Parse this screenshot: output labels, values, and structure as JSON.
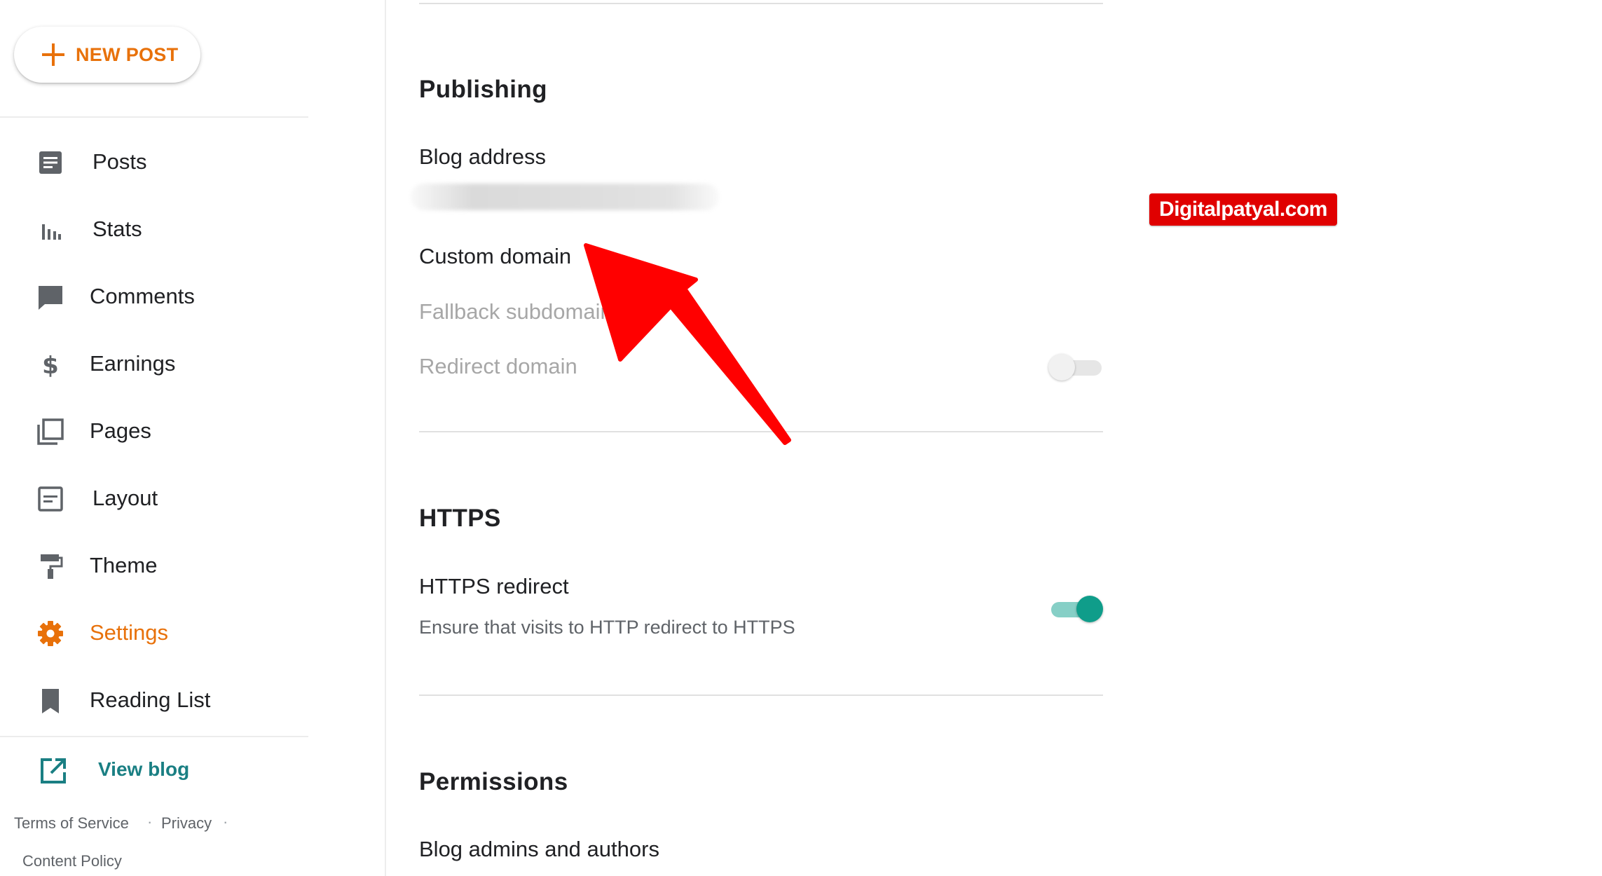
{
  "sidebar": {
    "new_post_label": "NEW POST",
    "items": [
      {
        "label": "Posts",
        "icon": "posts-icon"
      },
      {
        "label": "Stats",
        "icon": "stats-icon"
      },
      {
        "label": "Comments",
        "icon": "comments-icon"
      },
      {
        "label": "Earnings",
        "icon": "earnings-icon"
      },
      {
        "label": "Pages",
        "icon": "pages-icon"
      },
      {
        "label": "Layout",
        "icon": "layout-icon"
      },
      {
        "label": "Theme",
        "icon": "theme-icon"
      },
      {
        "label": "Settings",
        "icon": "settings-icon",
        "active": true
      },
      {
        "label": "Reading List",
        "icon": "reading-list-icon"
      }
    ],
    "view_blog_label": "View blog",
    "footer": {
      "terms": "Terms of Service",
      "privacy": "Privacy",
      "content_policy": "Content Policy",
      "separator": "·"
    }
  },
  "main": {
    "publishing": {
      "heading": "Publishing",
      "blog_address_label": "Blog address",
      "custom_domain_label": "Custom domain",
      "fallback_subdomain_label": "Fallback subdomain",
      "redirect_domain_label": "Redirect domain",
      "redirect_domain_enabled": false
    },
    "https": {
      "heading": "HTTPS",
      "redirect_label": "HTTPS redirect",
      "redirect_description": "Ensure that visits to HTTP redirect to HTTPS",
      "redirect_enabled": true
    },
    "permissions": {
      "heading": "Permissions",
      "admins_label": "Blog admins and authors"
    }
  },
  "watermark": "Digitalpatyal.com",
  "colors": {
    "accent": "#e8710a",
    "link": "#1a7f83",
    "toggle_on": "#0f9d8a",
    "annotation_arrow": "#ff0000",
    "watermark_bg": "#e00000"
  }
}
